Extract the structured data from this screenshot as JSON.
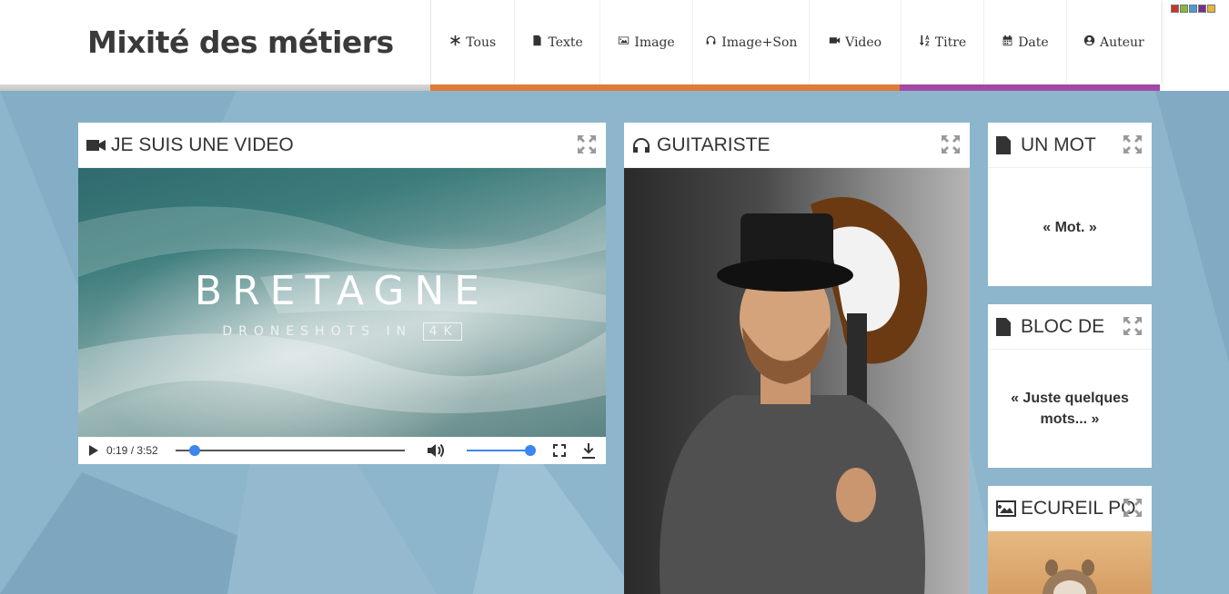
{
  "app": {
    "title": "Mixité des métiers"
  },
  "nav": {
    "items": [
      {
        "label": "Tous",
        "icon": "asterisk-icon"
      },
      {
        "label": "Texte",
        "icon": "document-icon"
      },
      {
        "label": "Image",
        "icon": "image-icon"
      },
      {
        "label": "Image+Son",
        "icon": "headphones-icon"
      },
      {
        "label": "Video",
        "icon": "video-camera-icon"
      },
      {
        "label": "Titre",
        "icon": "sort-alpha-icon"
      },
      {
        "label": "Date",
        "icon": "calendar-icon"
      },
      {
        "label": "Auteur",
        "icon": "user-circle-icon"
      }
    ]
  },
  "theme": {
    "swatches": [
      "#c8362b",
      "#8ab83b",
      "#4b9ad6",
      "#7a2d8c",
      "#e8b737"
    ],
    "accent_orange": "#e07b39",
    "accent_purple": "#a348a5",
    "background": "#8db6cc"
  },
  "cards": {
    "video": {
      "title": "JE SUIS UNE VIDEO",
      "icon": "video-camera-icon",
      "overlay_title": "BRETAGNE",
      "overlay_sub": "DRONESHOTS IN",
      "overlay_badge": "4K",
      "time": "0:19 / 3:52",
      "progress": 0.082,
      "volume": 1.0
    },
    "guitarist": {
      "title": "GUITARISTE",
      "icon": "headphones-icon"
    },
    "mot": {
      "title": "UN MOT",
      "icon": "document-icon",
      "text": "« Mot. »"
    },
    "bloc": {
      "title": "BLOC DE",
      "icon": "document-icon",
      "text": "« Juste quelques mots... »"
    },
    "ecureuil": {
      "title": "ECUREIL PO",
      "icon": "image-icon"
    }
  }
}
